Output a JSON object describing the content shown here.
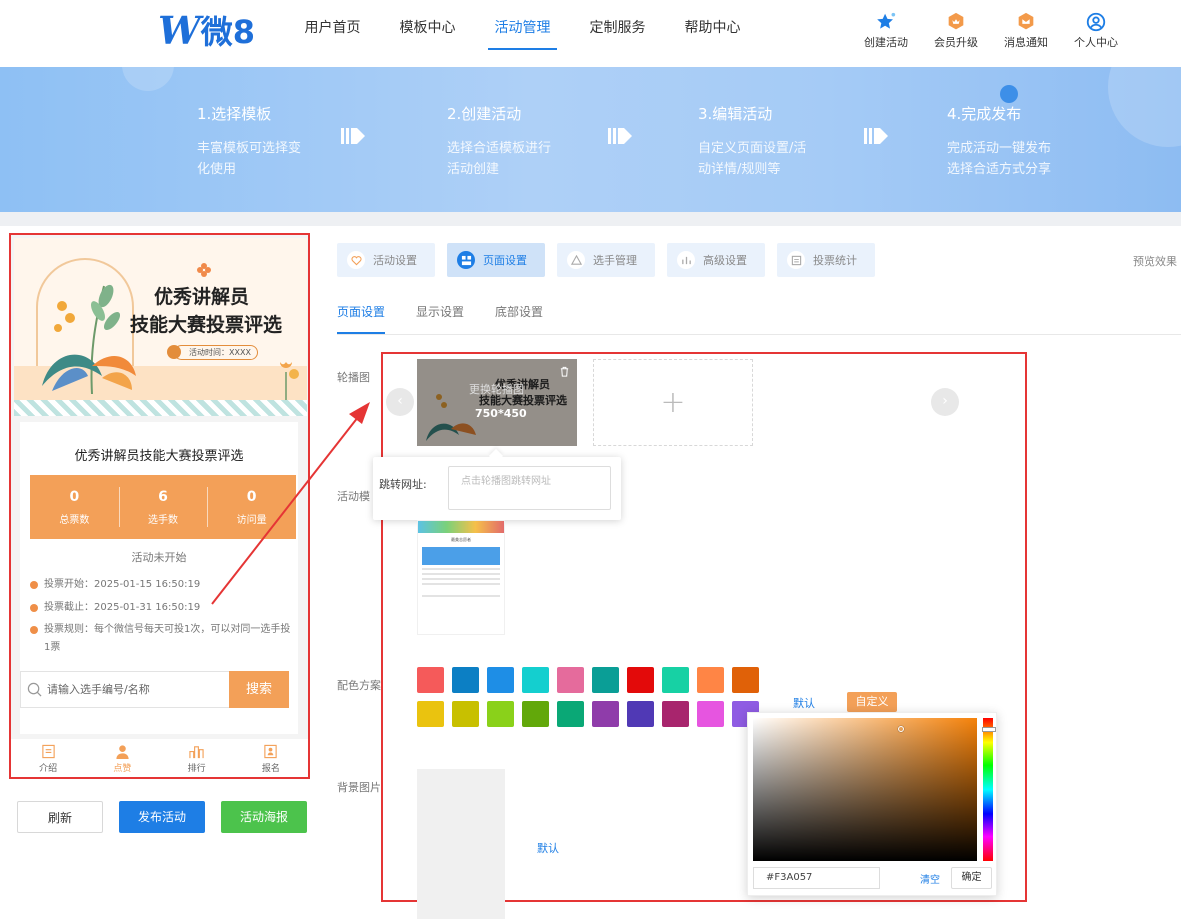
{
  "header": {
    "logo": {
      "mark": "W",
      "text": "微8"
    },
    "nav": [
      "用户首页",
      "模板中心",
      "活动管理",
      "定制服务",
      "帮助中心"
    ],
    "nav_active": 2,
    "tools": [
      {
        "label": "创建活动",
        "icon": "star-icon"
      },
      {
        "label": "会员升级",
        "icon": "crown-icon"
      },
      {
        "label": "消息通知",
        "icon": "bell-icon"
      },
      {
        "label": "个人中心",
        "icon": "user-icon"
      }
    ]
  },
  "banner": {
    "steps": [
      {
        "title": "1.选择模板",
        "desc": "丰富模板可选择变化使用"
      },
      {
        "title": "2.创建活动",
        "desc": "选择合适模板进行活动创建"
      },
      {
        "title": "3.编辑活动",
        "desc": "自定义页面设置/活动详情/规则等"
      },
      {
        "title": "4.完成发布",
        "desc": "完成活动一键发布选择合适方式分享"
      }
    ]
  },
  "preview": {
    "poster_title_1": "优秀讲解员",
    "poster_title_2": "技能大赛投票评选",
    "poster_time": "活动时间：XXXX",
    "card_title": "优秀讲解员技能大赛投票评选",
    "stats": [
      {
        "value": "0",
        "label": "总票数"
      },
      {
        "value": "6",
        "label": "选手数"
      },
      {
        "value": "0",
        "label": "访问量"
      }
    ],
    "status": "活动未开始",
    "rules": [
      "投票开始：2025-01-15 16:50:19",
      "投票截止：2025-01-31 16:50:19",
      "投票规则：每个微信号每天可投1次，可以对同一选手投1票"
    ],
    "search_placeholder": "请输入选手编号/名称",
    "search_button": "搜索",
    "tabbar": [
      {
        "label": "介绍",
        "icon": "doc-icon"
      },
      {
        "label": "点赞",
        "icon": "person-icon"
      },
      {
        "label": "排行",
        "icon": "rank-icon"
      },
      {
        "label": "报名",
        "icon": "signup-icon"
      }
    ],
    "tab_active": 1
  },
  "actions": {
    "refresh": "刷新",
    "publish": "发布活动",
    "poster": "活动海报"
  },
  "settings": {
    "tabs": [
      "活动设置",
      "页面设置",
      "选手管理",
      "高级设置",
      "投票统计"
    ],
    "tab_active": 1,
    "preview_link": "预览效果",
    "sub_tabs": [
      "页面设置",
      "显示设置",
      "底部设置"
    ],
    "sub_active": 0,
    "labels": {
      "carousel": "轮播图",
      "template": "活动模",
      "color": "配色方案",
      "bg": "背景图片"
    },
    "carousel": {
      "replace_text": "更换轮播图",
      "size_text": "750*450",
      "add_symbol": "+",
      "prev": "‹",
      "next": "›"
    },
    "jump": {
      "label": "跳转网址:",
      "placeholder": "点击轮播图跳转网址"
    },
    "template_thumb_title": "最美志愿者",
    "colors": [
      "#f55a5a",
      "#0c7fc4",
      "#1e8ee6",
      "#14cfcf",
      "#e56b9c",
      "#0a9e96",
      "#e30a0a",
      "#17d1a4",
      "#ff8545",
      "#e06108",
      "#eac30f",
      "#c8c000",
      "#8ad11a",
      "#62a80a",
      "#0aa876",
      "#8f3caa",
      "#5039b5",
      "#a8256d",
      "#e655e0",
      "#8f5ce3"
    ],
    "color_default": "默认",
    "color_custom": "自定义",
    "bg_default": "默认",
    "picker": {
      "hex": "#F3A057",
      "clear": "清空",
      "ok": "确定",
      "base_color": "#f5820a"
    }
  }
}
